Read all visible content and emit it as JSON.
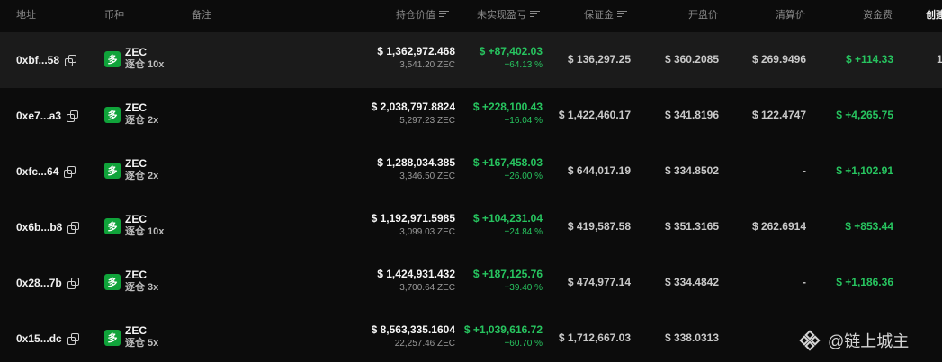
{
  "columns": {
    "address": "地址",
    "coin": "币种",
    "note": "备注",
    "position_value": "持仓价值",
    "unrealized_pnl": "未实现盈亏",
    "margin": "保证金",
    "entry_price": "开盘价",
    "liq_price": "清算价",
    "funding": "资金费",
    "created": "创建"
  },
  "rows": [
    {
      "address": "0xbf...58",
      "coin": "ZEC",
      "leverage": "逐仓 10x",
      "value_usd": "$ 1,362,972.468",
      "value_coin": "3,541.20 ZEC",
      "pnl": "$ +87,402.03",
      "pnl_pct": "+64.13 %",
      "margin": "$ 136,297.25",
      "entry": "$ 360.2085",
      "liq": "$ 269.9496",
      "funding": "$ +114.33",
      "extra": "1"
    },
    {
      "address": "0xe7...a3",
      "coin": "ZEC",
      "leverage": "逐仓 2x",
      "value_usd": "$ 2,038,797.8824",
      "value_coin": "5,297.23 ZEC",
      "pnl": "$ +228,100.43",
      "pnl_pct": "+16.04 %",
      "margin": "$ 1,422,460.17",
      "entry": "$ 341.8196",
      "liq": "$ 122.4747",
      "funding": "$ +4,265.75",
      "extra": ""
    },
    {
      "address": "0xfc...64",
      "coin": "ZEC",
      "leverage": "逐仓 2x",
      "value_usd": "$ 1,288,034.385",
      "value_coin": "3,346.50 ZEC",
      "pnl": "$ +167,458.03",
      "pnl_pct": "+26.00 %",
      "margin": "$ 644,017.19",
      "entry": "$ 334.8502",
      "liq": "-",
      "funding": "$ +1,102.91",
      "extra": ""
    },
    {
      "address": "0x6b...b8",
      "coin": "ZEC",
      "leverage": "逐仓 10x",
      "value_usd": "$ 1,192,971.5985",
      "value_coin": "3,099.03 ZEC",
      "pnl": "$ +104,231.04",
      "pnl_pct": "+24.84 %",
      "margin": "$ 419,587.58",
      "entry": "$ 351.3165",
      "liq": "$ 262.6914",
      "funding": "$ +853.44",
      "extra": ""
    },
    {
      "address": "0x28...7b",
      "coin": "ZEC",
      "leverage": "逐仓 3x",
      "value_usd": "$ 1,424,931.432",
      "value_coin": "3,700.64 ZEC",
      "pnl": "$ +187,125.76",
      "pnl_pct": "+39.40 %",
      "margin": "$ 474,977.14",
      "entry": "$ 334.4842",
      "liq": "-",
      "funding": "$ +1,186.36",
      "extra": ""
    },
    {
      "address": "0x15...dc",
      "coin": "ZEC",
      "leverage": "逐仓 5x",
      "value_usd": "$ 8,563,335.1604",
      "value_coin": "22,257.46 ZEC",
      "pnl": "$ +1,039,616.72",
      "pnl_pct": "+60.70 %",
      "margin": "$ 1,712,667.03",
      "entry": "$ 338.0313",
      "liq": "",
      "funding": "",
      "extra": ""
    }
  ],
  "badge_glyph": "多",
  "watermark": "@链上城主",
  "icons": {
    "copy": "copy-icon",
    "sort": "sort-icon",
    "watermark_logo": "binance-square-logo-icon"
  },
  "colors": {
    "background": "#0c0c0c",
    "row_highlight": "#1b1b1b",
    "positive": "#27c45f",
    "badge": "#10a33a"
  }
}
